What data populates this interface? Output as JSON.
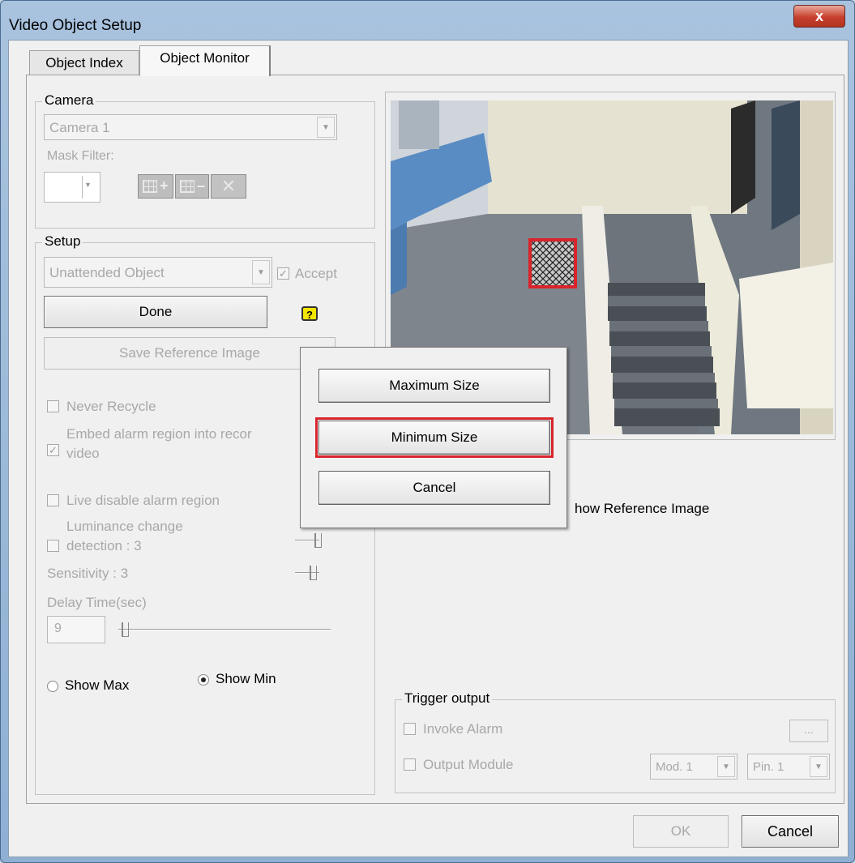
{
  "window": {
    "title": "Video Object Setup",
    "close_label": "x"
  },
  "tabs": [
    {
      "label": "Object Index"
    },
    {
      "label": "Object Monitor"
    }
  ],
  "camera": {
    "group_label": "Camera",
    "selected": "Camera 1",
    "mask_filter_label": "Mask Filter:"
  },
  "setup": {
    "group_label": "Setup",
    "mode_selected": "Unattended Object",
    "accept_label": "Accept",
    "done_label": "Done",
    "help_icon": "?",
    "save_reference_label": "Save Reference Image",
    "never_recycle_label": "Never Recycle",
    "embed_alarm_label_line1": "Embed alarm region into recor",
    "embed_alarm_label_line2": "video",
    "live_disable_label": "Live disable alarm region",
    "luminance_line1": "Luminance change",
    "luminance_line2": "detection : 3",
    "sensitivity_label": "Sensitivity : 3",
    "delay_label": "Delay Time(sec)",
    "delay_value": "9",
    "show_max_label": "Show Max",
    "show_min_label": "Show Min",
    "show_min_selected": true,
    "accept_checked": true,
    "embed_checked": true
  },
  "preview": {
    "show_reference_label": "how Reference Image"
  },
  "popup_menu": {
    "items": [
      {
        "label": "Maximum Size"
      },
      {
        "label": "Minimum Size"
      },
      {
        "label": "Cancel"
      }
    ],
    "highlight_color": "#d9242b"
  },
  "trigger": {
    "group_label": "Trigger output",
    "invoke_alarm_label": "Invoke Alarm",
    "ellipsis_label": "...",
    "output_module_label": "Output Module",
    "module_selected": "Mod. 1",
    "pin_selected": "Pin. 1"
  },
  "footer": {
    "ok_label": "OK",
    "cancel_label": "Cancel"
  }
}
